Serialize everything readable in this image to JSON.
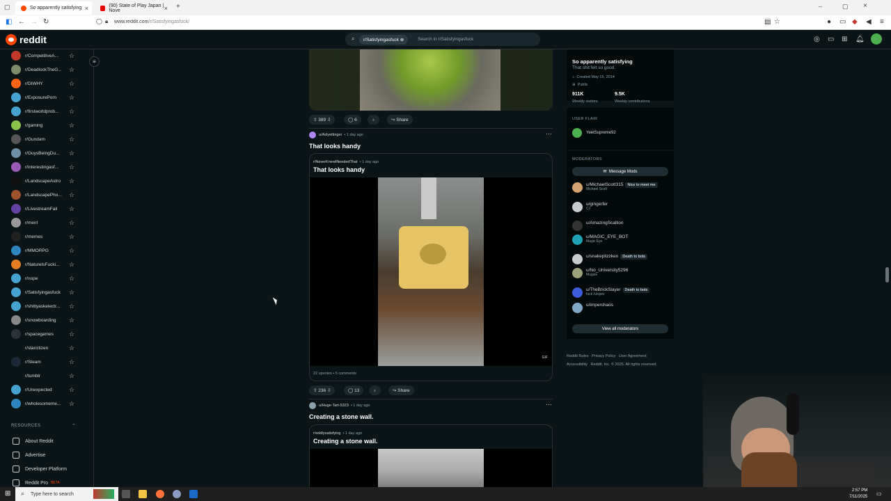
{
  "browser": {
    "tabs": [
      {
        "title": "So apparently satisfying",
        "close": "×"
      },
      {
        "title": "(90) State of Play Japan | Nove",
        "close": "×"
      }
    ],
    "new_tab": "+",
    "url_host": "www.reddit.com",
    "url_path": "/r/Satisfyingasfuck/",
    "window_controls": [
      "–",
      "▢",
      "×"
    ]
  },
  "header": {
    "logo": "reddit",
    "search_chip": "r/Satisfyingasfuck",
    "search_placeholder": "Search in r/Satisfyingasfuck"
  },
  "sidebar": {
    "items": [
      {
        "label": "r/CompetitiveA...",
        "color": "#c0392b"
      },
      {
        "label": "r/DeadlockTheG...",
        "color": "#7f8c6a"
      },
      {
        "label": "r/DIWHY",
        "color": "#ff6314"
      },
      {
        "label": "r/ExposurePorn",
        "color": "#46a3d1"
      },
      {
        "label": "r/firstworldprob...",
        "color": "#46a3d1"
      },
      {
        "label": "r/gaming",
        "color": "#8bc34a"
      },
      {
        "label": "r/Gundam",
        "color": "#555555"
      },
      {
        "label": "r/GuysBeingDu...",
        "color": "#6d8fa5"
      },
      {
        "label": "r/interestingasf...",
        "color": "#9b59b6"
      },
      {
        "label": "r/LandscapeAstro",
        "color": "#111111"
      },
      {
        "label": "r/LandscapePho...",
        "color": "#a0522d"
      },
      {
        "label": "r/LivestreamFail",
        "color": "#6441a5"
      },
      {
        "label": "r/meirl",
        "color": "#999999"
      },
      {
        "label": "r/memes",
        "color": "#222222"
      },
      {
        "label": "r/MMORPG",
        "color": "#2e86c1"
      },
      {
        "label": "r/NatureIsFucki...",
        "color": "#e67e22"
      },
      {
        "label": "r/nope",
        "color": "#46a3d1"
      },
      {
        "label": "r/Satisfyingasfuck",
        "color": "#46a3d1"
      },
      {
        "label": "r/shittyaskelectr...",
        "color": "#46a3d1"
      },
      {
        "label": "r/snowboarding",
        "color": "#888888"
      },
      {
        "label": "r/spacegames",
        "color": "#2a3236"
      },
      {
        "label": "r/starcitizen",
        "color": "#0b1416"
      },
      {
        "label": "r/Steam",
        "color": "#1b2838"
      },
      {
        "label": "r/tumblr",
        "color": "#0b1416"
      },
      {
        "label": "r/Unexpected",
        "color": "#46a3d1"
      },
      {
        "label": "r/wholesomeme...",
        "color": "#2e86c1"
      }
    ],
    "resources_heading": "RESOURCES",
    "resources": [
      "About Reddit",
      "Advertise",
      "Developer Platform",
      "Reddit Pro"
    ],
    "beta": "BETA"
  },
  "posts": {
    "top_actions": {
      "votes": "389",
      "comments": "6",
      "share": "Share"
    },
    "post1": {
      "author": "u/Aslyettinger",
      "time": "1 day ago",
      "title": "That looks handy",
      "xpost_sub": "r/NeverKnewINeededThat",
      "xpost_time": "1 day ago",
      "xpost_title": "That looks handy",
      "gif": "GIF",
      "upvotes": "22 upvotes",
      "xpost_comments": "5 comments",
      "votes": "236",
      "comments": "13",
      "share": "Share"
    },
    "post2": {
      "author": "u/Huge-Tart-5323",
      "time": "1 day ago",
      "title": "Creating a stone wall.",
      "xpost_sub": "r/oddlysatisfying",
      "xpost_time": "1 day ago",
      "xpost_title": "Creating a stone wall."
    }
  },
  "about": {
    "name": "So apparently satisfying",
    "desc": "That shit felt so good.",
    "created": "Created May 15, 2014",
    "visibility": "Public",
    "visitors": "911K",
    "visitors_label": "Weekly visitors",
    "contrib": "9.5K",
    "contrib_label": "Weekly contributions",
    "flair_heading": "USER FLAIR",
    "flair_user": "YeetSupreme92",
    "mods_heading": "MODERATORS",
    "message_mods": "Message Mods",
    "view_all": "View all moderators"
  },
  "moderators": [
    {
      "name": "u/MichaelScott315",
      "sub": "Michael Scott",
      "tag": "Nice to meet me",
      "color": "#d4a373"
    },
    {
      "name": "u/gingerfer",
      "sub": "CJ",
      "tag": "",
      "color": "#c8cbcd"
    },
    {
      "name": "u/AmazingScallion",
      "sub": "",
      "tag": "",
      "color": "#333333"
    },
    {
      "name": "u/MAGIC_EYE_BOT",
      "sub": "Magic Eye",
      "tag": "",
      "color": "#1fa2b5"
    },
    {
      "name": "u/snakeplizzken",
      "sub": "",
      "tag": "Death to bots",
      "color": "#c8cbcd"
    },
    {
      "name": "u/No_University5296",
      "sub": "Mugsie",
      "tag": "",
      "color": "#9aa07a"
    },
    {
      "name": "u/TheBrickSlayer",
      "sub": "fuck /u/spez",
      "tag": "Death to bots",
      "color": "#3b5bdb"
    },
    {
      "name": "u/imperchaos",
      "sub": "",
      "tag": "",
      "color": "#7fa7c7"
    }
  ],
  "footer_links": [
    "Reddit Rules",
    "Privacy Policy",
    "User Agreement",
    "Accessibility",
    "Reddit, Inc. © 2025. All rights reserved."
  ],
  "taskbar": {
    "search": "Type here to search",
    "time": "2:57 PM",
    "date": "7/11/2025"
  }
}
